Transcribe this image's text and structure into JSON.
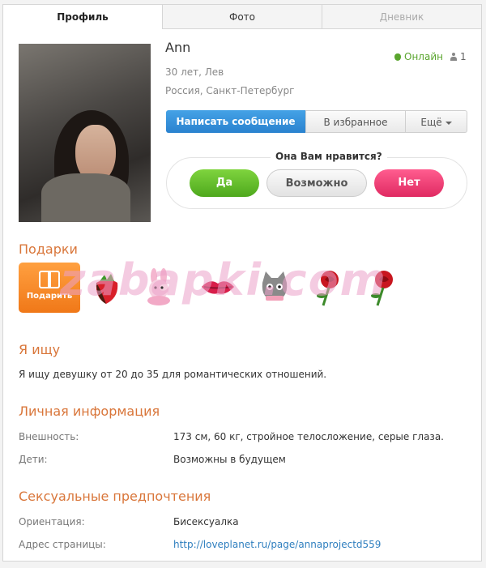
{
  "tabs": [
    {
      "label": "Профиль",
      "state": "active"
    },
    {
      "label": "Фото",
      "state": "normal"
    },
    {
      "label": "Дневник",
      "state": "disabled"
    }
  ],
  "profile": {
    "name": "Ann",
    "age_sign": "30 лет, Лев",
    "location": "Россия, Санкт-Петербург",
    "online_label": "Онлайн",
    "count": "1",
    "colors": {
      "online": "#5aa52e",
      "accent": "#d9763a",
      "link": "#2f7fbf"
    }
  },
  "actions": {
    "message": "Написать сообщение",
    "favorite": "В избранное",
    "more": "Ещё"
  },
  "like": {
    "question": "Она Вам нравится?",
    "yes": "Да",
    "maybe": "Возможно",
    "no": "Нет"
  },
  "gifts": {
    "title": "Подарки",
    "button": "Подарить",
    "items": [
      "strawberry-icon",
      "bunny-icon",
      "lips-icon",
      "cat-icon",
      "rose-icon",
      "rose-icon"
    ]
  },
  "watermark": "zabapki.com",
  "seeking": {
    "title": "Я ищу",
    "text": "Я ищу девушку от 20 до 35 для романтических отношений."
  },
  "personal": {
    "title": "Личная информация",
    "rows": [
      {
        "label": "Внешность:",
        "value": "173 см, 60 кг, стройное телосложение, серые глаза."
      },
      {
        "label": "Дети:",
        "value": "Возможны в будущем"
      }
    ]
  },
  "sexual": {
    "title": "Сексуальные предпочтения",
    "rows": [
      {
        "label": "Ориентация:",
        "value": "Бисексуалка"
      },
      {
        "label": "Адрес страницы:",
        "value": "http://loveplanet.ru/page/annaprojectd559"
      }
    ]
  }
}
